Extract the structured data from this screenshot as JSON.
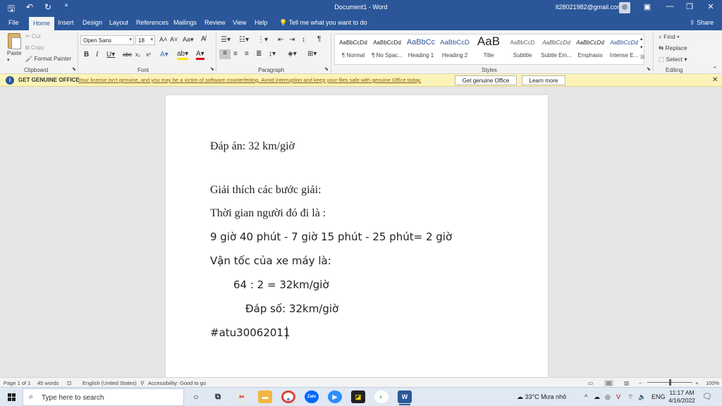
{
  "titlebar": {
    "doc_title": "Document1 - Word",
    "email": "lt28021982@gmail.com"
  },
  "menu": {
    "tabs": [
      "File",
      "Home",
      "Insert",
      "Design",
      "Layout",
      "References",
      "Mailings",
      "Review",
      "View",
      "Help"
    ],
    "active_tab": "Home",
    "tell_me": "Tell me what you want to do",
    "share": "Share"
  },
  "ribbon": {
    "clipboard": {
      "label": "Clipboard",
      "paste": "Paste",
      "cut": "Cut",
      "copy": "Copy",
      "format_painter": "Format Painter"
    },
    "font": {
      "label": "Font",
      "font_name": "Open Sans",
      "font_size": "18"
    },
    "paragraph": {
      "label": "Paragraph"
    },
    "styles": {
      "label": "Styles",
      "items": [
        {
          "sample": "AaBbCcDd",
          "name": "¶ Normal"
        },
        {
          "sample": "AaBbCcDd",
          "name": "¶ No Spac..."
        },
        {
          "sample": "AaBbCc",
          "name": "Heading 1"
        },
        {
          "sample": "AaBbCcD",
          "name": "Heading 2"
        },
        {
          "sample": "AaB",
          "name": "Title"
        },
        {
          "sample": "AaBbCcD",
          "name": "Subtitle"
        },
        {
          "sample": "AaBbCcDd",
          "name": "Subtle Em..."
        },
        {
          "sample": "AaBbCcDd",
          "name": "Emphasis"
        },
        {
          "sample": "AaBbCcDd",
          "name": "Intense E..."
        }
      ]
    },
    "editing": {
      "label": "Editing",
      "find": "Find",
      "replace": "Replace",
      "select": "Select"
    }
  },
  "infobar": {
    "title": "GET GENUINE OFFICE",
    "message": "Your license isn't genuine, and you may be a victim of software counterfeiting. Avoid interruption and keep your files safe with genuine Office today.",
    "get_button": "Get genuine Office",
    "learn_button": "Learn more"
  },
  "document": {
    "lines": [
      "Đáp án: 32 km/giờ",
      "Giải thích các bước giải:",
      "Thời gian người đó đi là :",
      "9 giờ 40 phút - 7 giờ 15 phút - 25 phút= 2 giờ",
      "Vận tốc của xe máy là:",
      "64 : 2 = 32km/giờ",
      "Đáp số: 32km/giờ",
      "#atu30062011"
    ]
  },
  "statusbar": {
    "page": "Page 1 of 1",
    "words": "45 words",
    "language": "English (United States)",
    "accessibility": "Accessibility: Good to go",
    "zoom": "100%"
  },
  "taskbar": {
    "search_placeholder": "Type here to search",
    "weather": "33°C  Mưa nhỏ",
    "lang": "ENG",
    "time": "11:17 AM",
    "date": "4/16/2022"
  },
  "colors": {
    "word_blue": "#2b579a",
    "infobar_bg": "#fcf3b8"
  }
}
